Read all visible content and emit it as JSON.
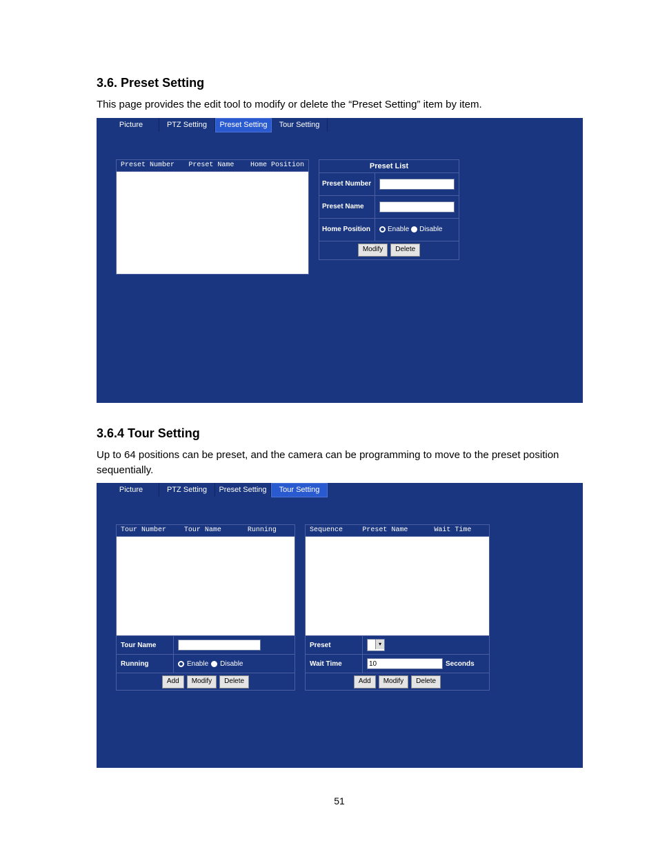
{
  "section_preset": {
    "heading": "3.6.   Preset Setting",
    "body": "This page provides the edit tool to modify or delete the “Preset Setting” item by item."
  },
  "section_tour": {
    "heading": "3.6.4 Tour Setting",
    "body": "Up to 64 positions can be preset, and the camera can be programming to move to the preset position sequentially."
  },
  "tabs": {
    "picture": "Picture",
    "ptz": "PTZ Setting",
    "preset": "Preset Setting",
    "tour": "Tour Setting"
  },
  "preset_panel": {
    "cols": {
      "preset_number": "Preset Number",
      "preset_name": "Preset Name",
      "home_position": "Home Position"
    },
    "form_title": "Preset List",
    "labels": {
      "preset_number": "Preset Number",
      "preset_name": "Preset Name",
      "home_position": "Home Position"
    },
    "radio": {
      "enable": "Enable",
      "disable": "Disable"
    },
    "buttons": {
      "modify": "Modify",
      "delete": "Delete"
    }
  },
  "tour_panel": {
    "left_cols": {
      "tour_number": "Tour Number",
      "tour_name": "Tour Name",
      "running": "Running"
    },
    "right_cols": {
      "sequence": "Sequence",
      "preset_name": "Preset Name",
      "wait_time": "Wait Time"
    },
    "labels": {
      "tour_name": "Tour Name",
      "running": "Running",
      "preset": "Preset",
      "wait_time": "Wait Time"
    },
    "radio": {
      "enable": "Enable",
      "disable": "Disable"
    },
    "wait_time_value": "10",
    "seconds": "Seconds",
    "buttons": {
      "add": "Add",
      "modify": "Modify",
      "delete": "Delete"
    }
  },
  "page_number": "51"
}
